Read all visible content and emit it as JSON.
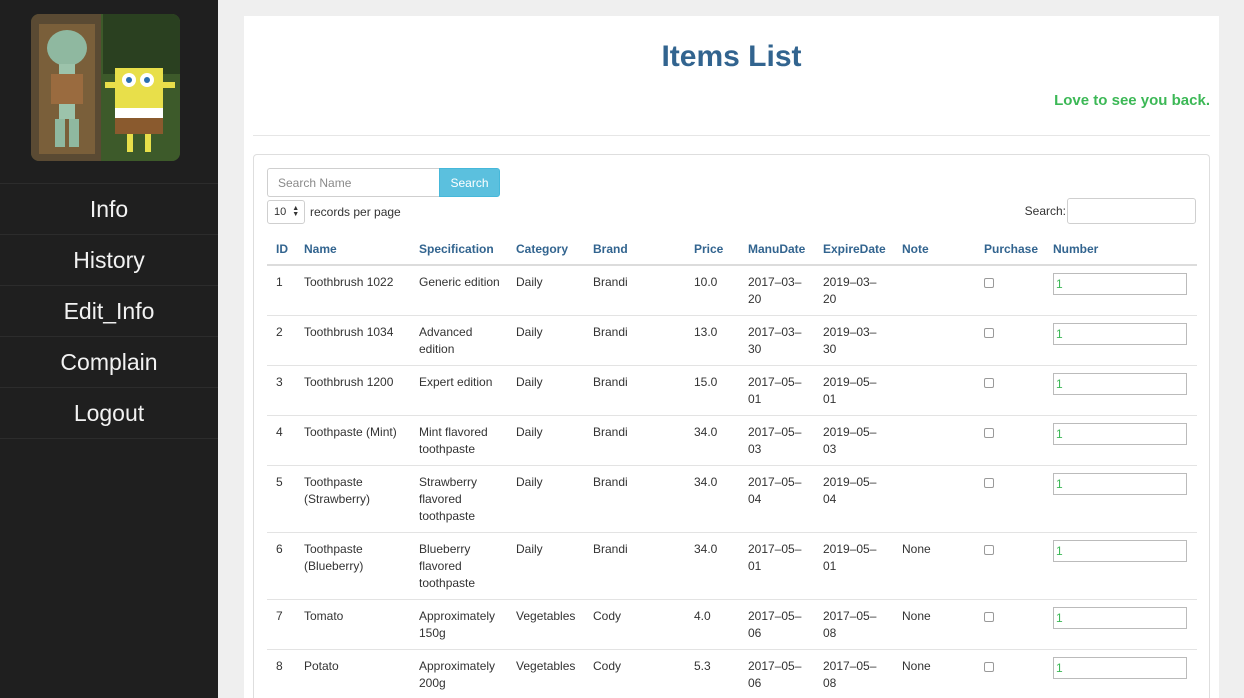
{
  "sidebar": {
    "nav": [
      "Info",
      "History",
      "Edit_Info",
      "Complain",
      "Logout"
    ]
  },
  "header": {
    "title": "Items List",
    "welcome": "Love to see you back."
  },
  "search": {
    "placeholder": "Search Name",
    "button_label": "Search"
  },
  "length": {
    "value": "10",
    "label": "records per page"
  },
  "filter": {
    "label": "Search:"
  },
  "table": {
    "columns": [
      "ID",
      "Name",
      "Specification",
      "Category",
      "Brand",
      "Price",
      "ManuDate",
      "ExpireDate",
      "Note",
      "Purchase",
      "Number"
    ],
    "rows": [
      {
        "id": "1",
        "name": "Toothbrush 1022",
        "spec": "Generic edition",
        "category": "Daily",
        "brand": "Brandi",
        "price": "10.0",
        "manu": "2017–03–20",
        "expire": "2019–03–20",
        "note": "",
        "number": "1"
      },
      {
        "id": "2",
        "name": "Toothbrush 1034",
        "spec": "Advanced edition",
        "category": "Daily",
        "brand": "Brandi",
        "price": "13.0",
        "manu": "2017–03–30",
        "expire": "2019–03–30",
        "note": "",
        "number": "1"
      },
      {
        "id": "3",
        "name": "Toothbrush 1200",
        "spec": "Expert edition",
        "category": "Daily",
        "brand": "Brandi",
        "price": "15.0",
        "manu": "2017–05–01",
        "expire": "2019–05–01",
        "note": "",
        "number": "1"
      },
      {
        "id": "4",
        "name": "Toothpaste (Mint)",
        "spec": "Mint flavored toothpaste",
        "category": "Daily",
        "brand": "Brandi",
        "price": "34.0",
        "manu": "2017–05–03",
        "expire": "2019–05–03",
        "note": "",
        "number": "1"
      },
      {
        "id": "5",
        "name": "Toothpaste (Strawberry)",
        "spec": "Strawberry flavored toothpaste",
        "category": "Daily",
        "brand": "Brandi",
        "price": "34.0",
        "manu": "2017–05–04",
        "expire": "2019–05–04",
        "note": "",
        "number": "1"
      },
      {
        "id": "6",
        "name": "Toothpaste (Blueberry)",
        "spec": "Blueberry flavored toothpaste",
        "category": "Daily",
        "brand": "Brandi",
        "price": "34.0",
        "manu": "2017–05–01",
        "expire": "2019–05–01",
        "note": "None",
        "number": "1"
      },
      {
        "id": "7",
        "name": "Tomato",
        "spec": "Approximately 150g",
        "category": "Vegetables",
        "brand": "Cody",
        "price": "4.0",
        "manu": "2017–05–06",
        "expire": "2017–05–08",
        "note": "None",
        "number": "1"
      },
      {
        "id": "8",
        "name": "Potato",
        "spec": "Approximately 200g",
        "category": "Vegetables",
        "brand": "Cody",
        "price": "5.3",
        "manu": "2017–05–06",
        "expire": "2017–05–08",
        "note": "None",
        "number": "1"
      }
    ]
  }
}
